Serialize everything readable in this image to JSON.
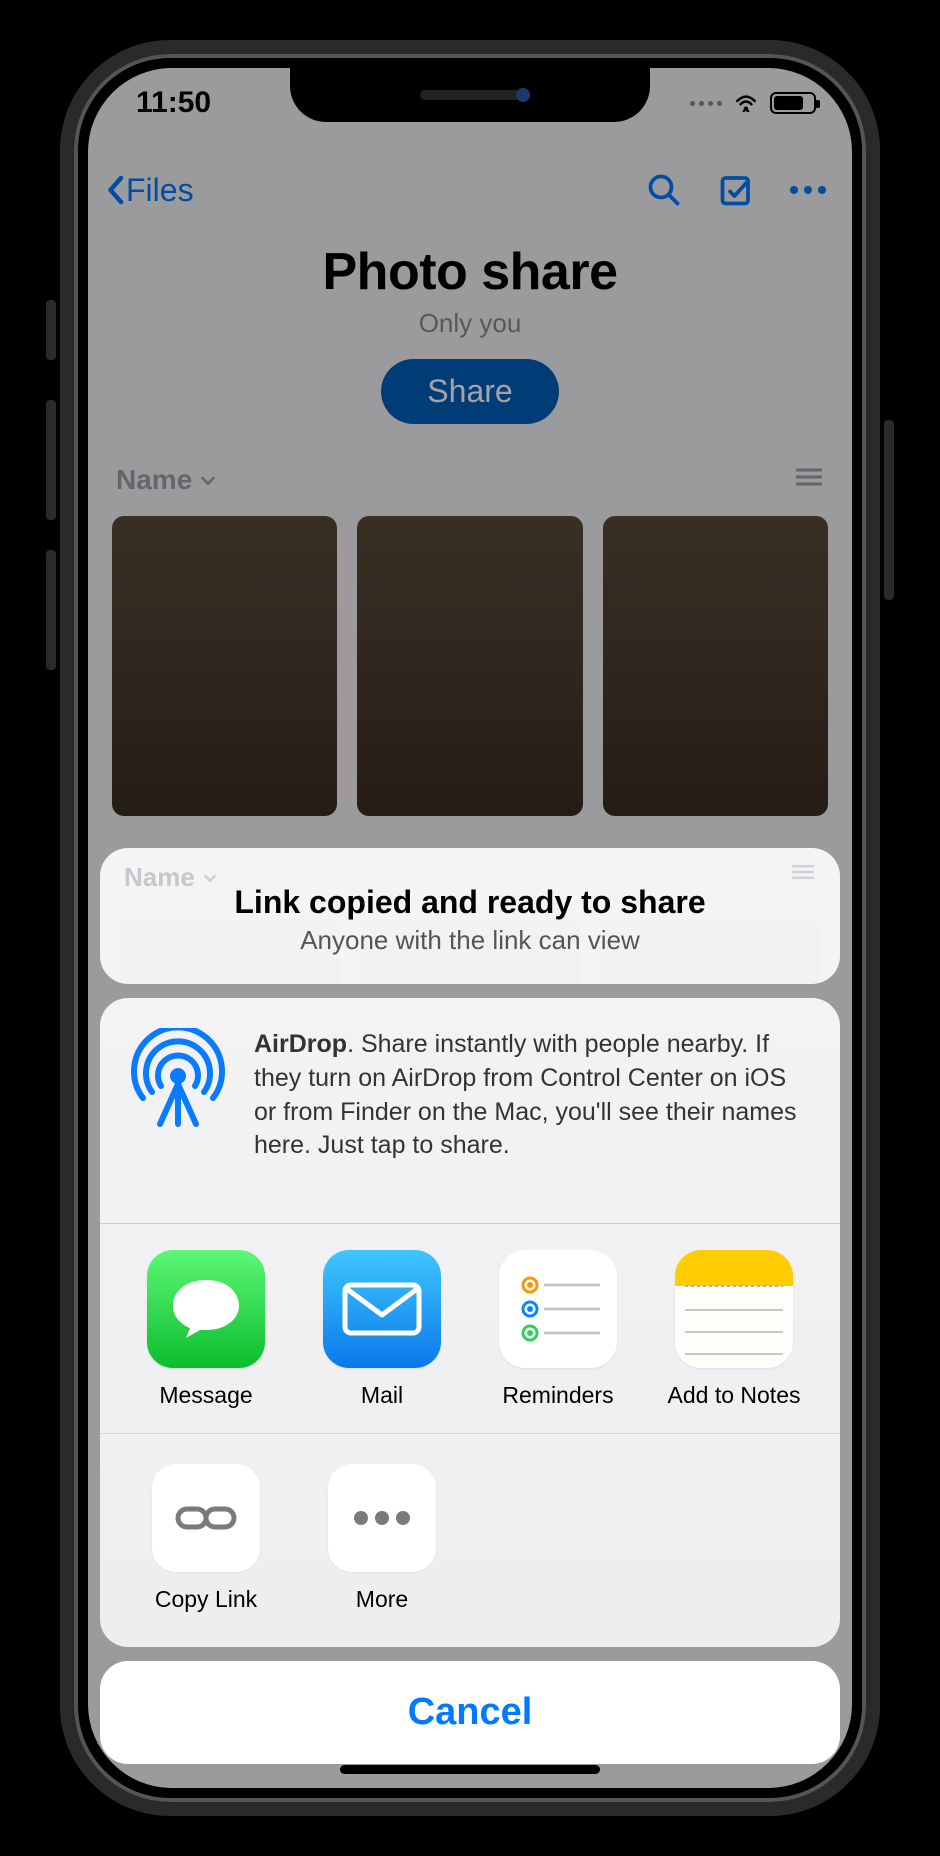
{
  "status": {
    "time": "11:50"
  },
  "nav": {
    "back_label": "Files"
  },
  "header": {
    "title": "Photo share",
    "subtitle": "Only you",
    "share_button": "Share"
  },
  "sort": {
    "label": "Name"
  },
  "share_sheet": {
    "top": {
      "title": "Link copied and ready to share",
      "subtitle": "Anyone with the link can view"
    },
    "airdrop": {
      "bold": "AirDrop",
      "body": ". Share instantly with people nearby. If they turn on AirDrop from Control Center on iOS or from Finder on the Mac, you'll see their names here. Just tap to share."
    },
    "apps": [
      {
        "label": "Message"
      },
      {
        "label": "Mail"
      },
      {
        "label": "Reminders"
      },
      {
        "label": "Add to Notes"
      }
    ],
    "actions": [
      {
        "label": "Copy Link"
      },
      {
        "label": "More"
      }
    ],
    "cancel": "Cancel"
  }
}
